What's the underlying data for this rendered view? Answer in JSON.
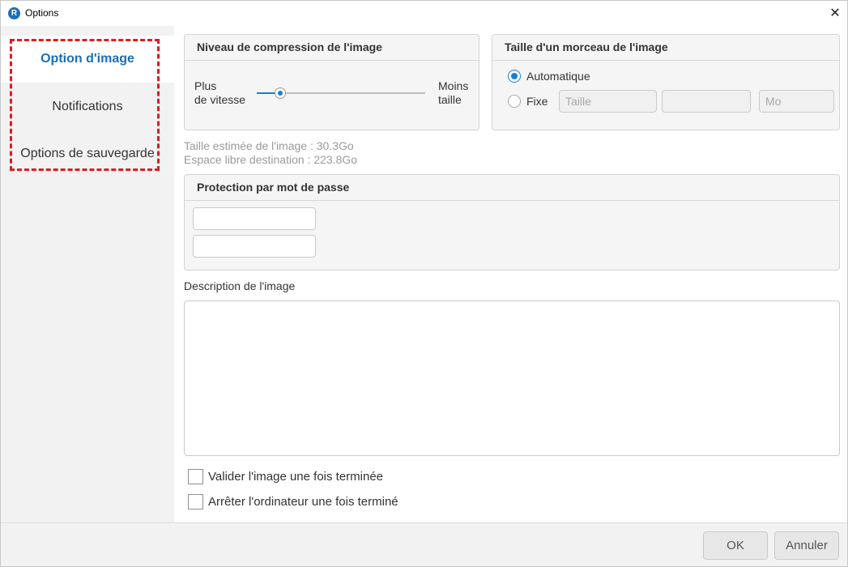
{
  "window": {
    "title": "Options",
    "app_icon_letter": "R",
    "close_glyph": "✕"
  },
  "sidebar": {
    "items": [
      {
        "label": "Option d'image"
      },
      {
        "label": "Notifications"
      },
      {
        "label": "Options de sauvegarde"
      }
    ]
  },
  "compression": {
    "header": "Niveau de compression de l'image",
    "left_label_line1": "Plus",
    "left_label_line2": "de vitesse",
    "right_label_line1": "Moins",
    "right_label_line2": "taille",
    "level_fraction": 0.14
  },
  "chunk_size": {
    "header": "Taille d'un morceau de l'image",
    "option_auto": "Automatique",
    "option_fixed": "Fixe",
    "selected": "Automatique",
    "size_placeholder": "Taille",
    "value": "",
    "unit_placeholder": "Mo"
  },
  "estimates": {
    "image_size": "Taille estimée de l'image : 30.3Go",
    "free_space": "Espace libre destination : 223.8Go"
  },
  "password": {
    "header": "Protection par mot de passe",
    "password_value": "",
    "confirm_value": ""
  },
  "description": {
    "label": "Description de l'image",
    "value": ""
  },
  "checkboxes": {
    "verify": {
      "label": "Valider l'image une fois terminée",
      "checked": false
    },
    "shutdown": {
      "label": "Arrêter l'ordinateur une fois terminé",
      "checked": false
    }
  },
  "footer": {
    "ok_label": "OK",
    "cancel_label": "Annuler"
  },
  "colors": {
    "accent": "#1a6fb8",
    "highlight_border": "#e01b24"
  }
}
